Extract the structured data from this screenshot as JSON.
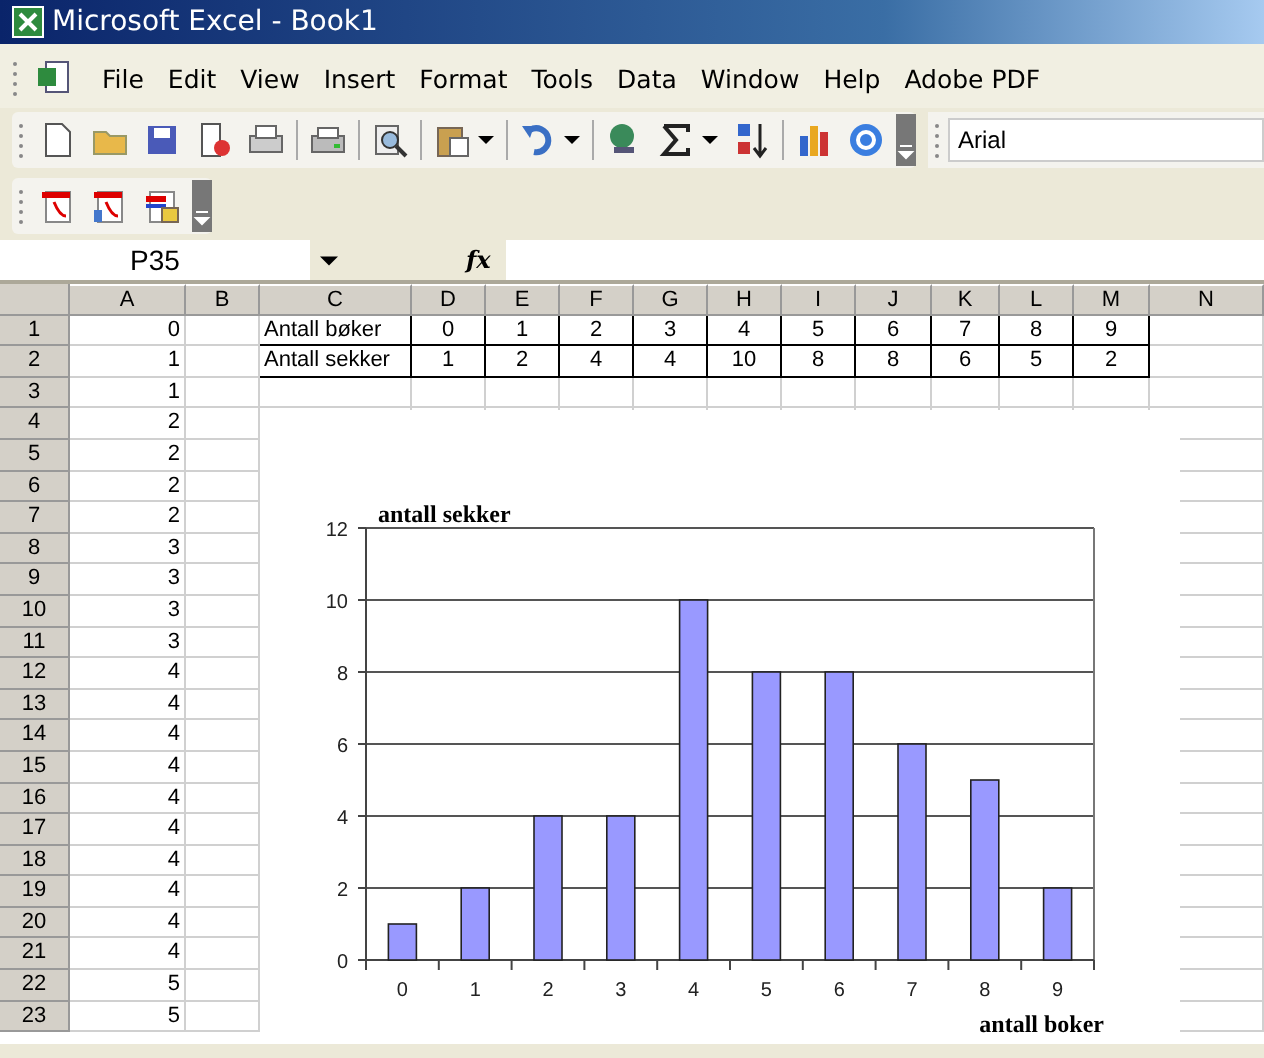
{
  "window": {
    "title": "Microsoft Excel - Book1"
  },
  "menu": [
    "File",
    "Edit",
    "View",
    "Insert",
    "Format",
    "Tools",
    "Data",
    "Window",
    "Help",
    "Adobe PDF"
  ],
  "font_box": {
    "value": "Arial"
  },
  "formula_bar": {
    "name_box": "P35",
    "fx_label": "fx"
  },
  "columns": [
    "A",
    "B",
    "C",
    "D",
    "E",
    "F",
    "G",
    "H",
    "I",
    "J",
    "K",
    "L",
    "M",
    "N"
  ],
  "rows": [
    {
      "number": "1",
      "cells": [
        "0",
        "",
        "Antall bøker",
        "0",
        "1",
        "2",
        "3",
        "4",
        "5",
        "6",
        "7",
        "8",
        "9",
        ""
      ]
    },
    {
      "number": "2",
      "cells": [
        "1",
        "",
        "Antall sekker",
        "1",
        "2",
        "4",
        "4",
        "10",
        "8",
        "8",
        "6",
        "5",
        "2",
        ""
      ]
    },
    {
      "number": "3",
      "cells": [
        "1"
      ]
    },
    {
      "number": "4",
      "cells": [
        "2"
      ]
    },
    {
      "number": "5",
      "cells": [
        "2"
      ]
    },
    {
      "number": "6",
      "cells": [
        "2"
      ]
    },
    {
      "number": "7",
      "cells": [
        "2"
      ]
    },
    {
      "number": "8",
      "cells": [
        "3"
      ]
    },
    {
      "number": "9",
      "cells": [
        "3"
      ]
    },
    {
      "number": "10",
      "cells": [
        "3"
      ]
    },
    {
      "number": "11",
      "cells": [
        "3"
      ]
    },
    {
      "number": "12",
      "cells": [
        "4"
      ]
    },
    {
      "number": "13",
      "cells": [
        "4"
      ]
    },
    {
      "number": "14",
      "cells": [
        "4"
      ]
    },
    {
      "number": "15",
      "cells": [
        "4"
      ]
    },
    {
      "number": "16",
      "cells": [
        "4"
      ]
    },
    {
      "number": "17",
      "cells": [
        "4"
      ]
    },
    {
      "number": "18",
      "cells": [
        "4"
      ]
    },
    {
      "number": "19",
      "cells": [
        "4"
      ]
    },
    {
      "number": "20",
      "cells": [
        "4"
      ]
    },
    {
      "number": "21",
      "cells": [
        "4"
      ]
    },
    {
      "number": "22",
      "cells": [
        "5"
      ]
    },
    {
      "number": "23",
      "cells": [
        "5"
      ]
    }
  ],
  "chart": {
    "chart_data": {
      "type": "bar",
      "ylabel": "antall sekker",
      "xlabel": "antall boker",
      "categories": [
        "0",
        "1",
        "2",
        "3",
        "4",
        "5",
        "6",
        "7",
        "8",
        "9"
      ],
      "values": [
        1,
        2,
        4,
        4,
        10,
        8,
        8,
        6,
        5,
        2
      ],
      "grid": true,
      "ylim": [
        0,
        12
      ],
      "yticks": [
        0,
        2,
        4,
        6,
        8,
        10,
        12
      ]
    }
  }
}
